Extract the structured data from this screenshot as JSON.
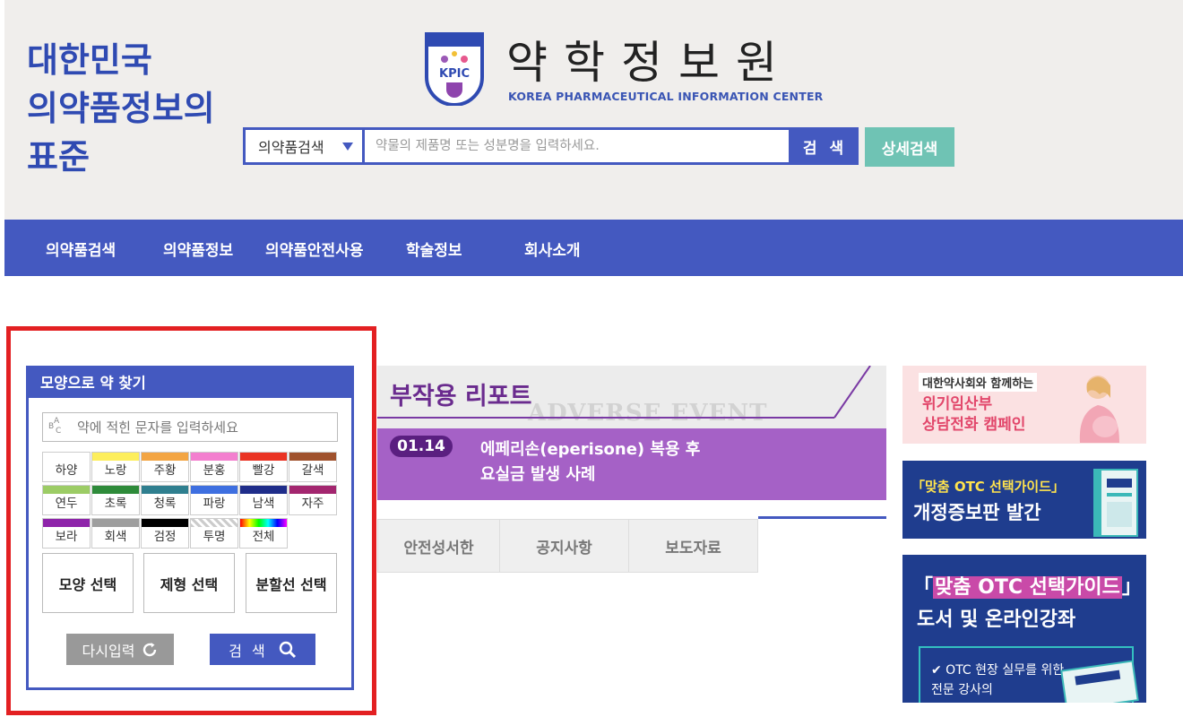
{
  "header": {
    "slogan_lines": [
      "대한민국",
      "의약품정보의",
      "표준"
    ],
    "logo_title": "약학정보원",
    "logo_subtitle": "KOREA PHARMACEUTICAL INFORMATION CENTER",
    "logo_emblem_text": "KPIC",
    "search": {
      "category": "의약품검색",
      "placeholder": "약물의 제품명 또는 성분명을 입력하세요.",
      "search_label": "검 색",
      "detail_label": "상세검색"
    }
  },
  "nav": {
    "items": [
      "의약품검색",
      "의약품정보",
      "의약품안전사용",
      "학술정보",
      "회사소개"
    ]
  },
  "shape_search": {
    "title": "모양으로 약 찾기",
    "imprint_placeholder": "약에 적힌 문자를 입력하세요",
    "colors": [
      {
        "label": "하양",
        "color": "#ffffff"
      },
      {
        "label": "노랑",
        "color": "#fdee5c"
      },
      {
        "label": "주황",
        "color": "#f3a543"
      },
      {
        "label": "분홍",
        "color": "#f37fcf"
      },
      {
        "label": "빨강",
        "color": "#ea3323"
      },
      {
        "label": "갈색",
        "color": "#a0522d"
      },
      {
        "label": "연두",
        "color": "#9ccc65"
      },
      {
        "label": "초록",
        "color": "#2e8b3a"
      },
      {
        "label": "청록",
        "color": "#2f7f8f"
      },
      {
        "label": "파랑",
        "color": "#3e6fe0"
      },
      {
        "label": "남색",
        "color": "#1f2d8a"
      },
      {
        "label": "자주",
        "color": "#a3266f"
      },
      {
        "label": "보라",
        "color": "#8e24aa"
      },
      {
        "label": "회색",
        "color": "#9e9e9e"
      },
      {
        "label": "검정",
        "color": "#000000"
      },
      {
        "label": "투명",
        "color": "checker"
      },
      {
        "label": "전체",
        "color": "rainbow"
      }
    ],
    "select_buttons": [
      "모양 선택",
      "제형 선택",
      "분할선 선택"
    ],
    "reset_label": "다시입력",
    "search_label": "검 색"
  },
  "banner": {
    "title": "부작용 리포트",
    "background_text": "ADVERSE EVENT REPORT",
    "date": "01.14",
    "text_lines": [
      "에페리손(eperisone) 복용 후",
      "요실금 발생 사례"
    ]
  },
  "tabs": [
    "안전성서한",
    "공지사항",
    "보도자료"
  ],
  "ads": {
    "ad1": {
      "tag": "대한약사회와 함께하는",
      "lines": [
        "위기임산부",
        "상담전화 캠페인"
      ]
    },
    "ad2": {
      "line1": "「맞춤 OTC 선택가이드」",
      "line2": "개정증보판 발간"
    },
    "ad3": {
      "line1_highlight": "맞춤 OTC 선택가이드",
      "line2": "도서 및 온라인강좌",
      "lines": [
        "✔ OTC 현장 실무를 위한",
        "전문 강사의"
      ]
    }
  }
}
